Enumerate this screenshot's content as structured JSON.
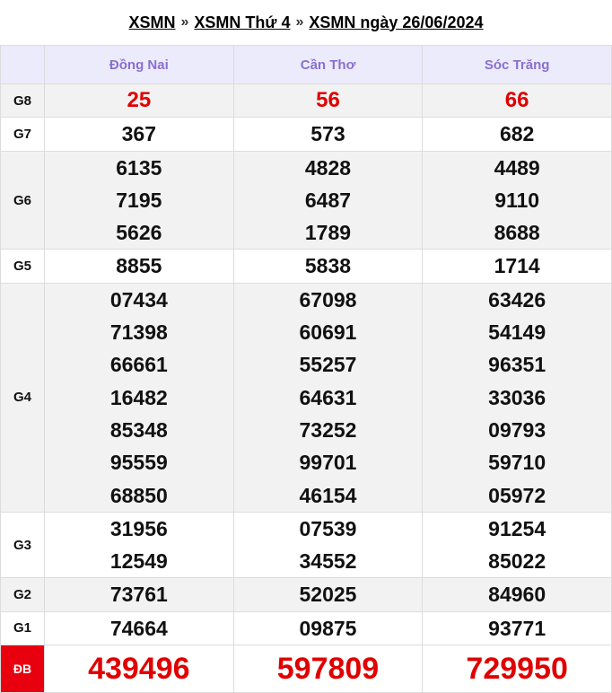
{
  "breadcrumb": {
    "items": [
      "XSMN",
      "XSMN Thứ 4",
      "XSMN ngày 26/06/2024"
    ],
    "separator": "»"
  },
  "columns": [
    "Đồng Nai",
    "Cần Thơ",
    "Sóc Trăng"
  ],
  "prizes": [
    {
      "label": "G8",
      "values": [
        [
          "25"
        ],
        [
          "56"
        ],
        [
          "66"
        ]
      ]
    },
    {
      "label": "G7",
      "values": [
        [
          "367"
        ],
        [
          "573"
        ],
        [
          "682"
        ]
      ]
    },
    {
      "label": "G6",
      "values": [
        [
          "6135",
          "7195",
          "5626"
        ],
        [
          "4828",
          "6487",
          "1789"
        ],
        [
          "4489",
          "9110",
          "8688"
        ]
      ]
    },
    {
      "label": "G5",
      "values": [
        [
          "8855"
        ],
        [
          "5838"
        ],
        [
          "1714"
        ]
      ]
    },
    {
      "label": "G4",
      "values": [
        [
          "07434",
          "71398",
          "66661",
          "16482",
          "85348",
          "95559",
          "68850"
        ],
        [
          "67098",
          "60691",
          "55257",
          "64631",
          "73252",
          "99701",
          "46154"
        ],
        [
          "63426",
          "54149",
          "96351",
          "33036",
          "09793",
          "59710",
          "05972"
        ]
      ]
    },
    {
      "label": "G3",
      "values": [
        [
          "31956",
          "12549"
        ],
        [
          "07539",
          "34552"
        ],
        [
          "91254",
          "85022"
        ]
      ]
    },
    {
      "label": "G2",
      "values": [
        [
          "73761"
        ],
        [
          "52025"
        ],
        [
          "84960"
        ]
      ]
    },
    {
      "label": "G1",
      "values": [
        [
          "74664"
        ],
        [
          "09875"
        ],
        [
          "93771"
        ]
      ]
    },
    {
      "label": "ĐB",
      "values": [
        [
          "439496"
        ],
        [
          "597809"
        ],
        [
          "729950"
        ]
      ]
    }
  ],
  "colors": {
    "header_text": "#8a6fd1",
    "header_bg": "#ecebfb",
    "accent_red": "#e00000",
    "db_label_bg": "#e8000f"
  }
}
